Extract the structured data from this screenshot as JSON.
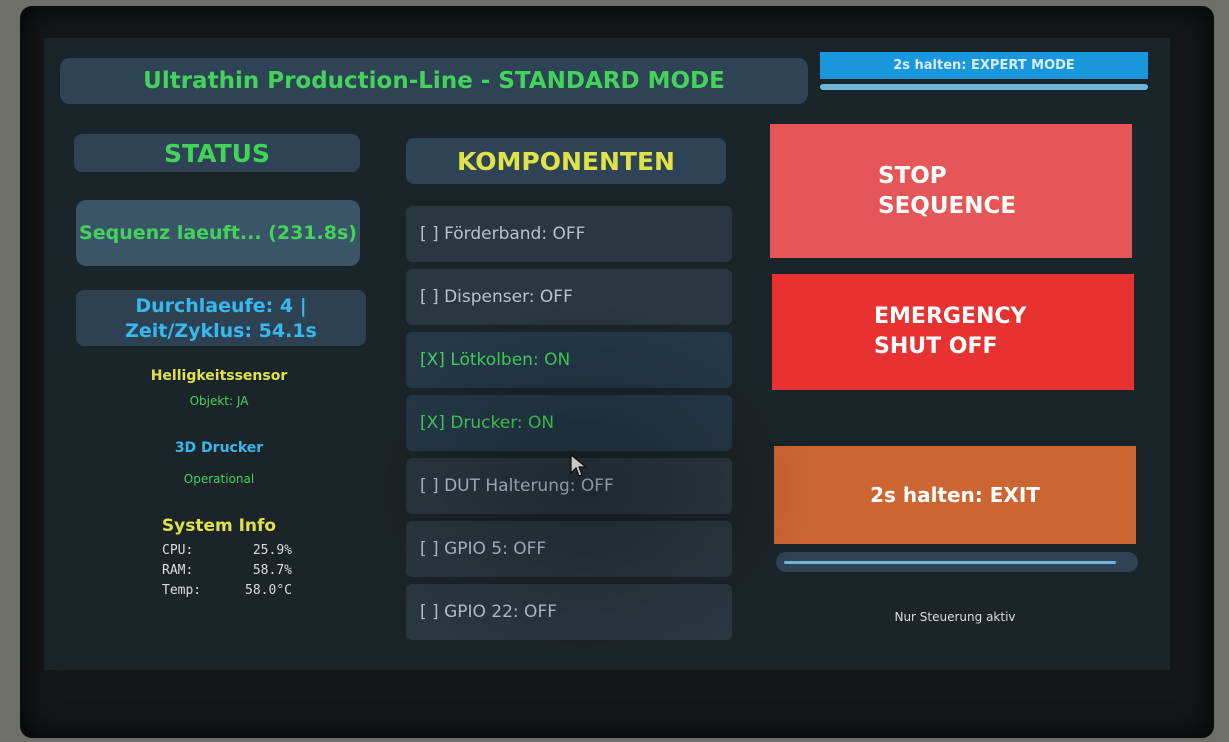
{
  "header": {
    "title": "Ultrathin Production-Line - STANDARD MODE",
    "expert_button": "2s halten: EXPERT MODE",
    "expert_hold_progress": 1.0
  },
  "status": {
    "header": "STATUS",
    "sequence": "Sequenz laeuft... (231.8s)",
    "cycles": "Durchlaeufe: 4 | Zeit/Zyklus: 54.1s",
    "brightness_sensor_title": "Helligkeitssensor",
    "brightness_sensor_value": "Objekt: JA",
    "printer_title": "3D Drucker",
    "printer_value": "Operational",
    "system_info_title": "System Info",
    "system_info": [
      {
        "label": "CPU:",
        "value": "25.9%"
      },
      {
        "label": "RAM:",
        "value": "58.7%"
      },
      {
        "label": "Temp:",
        "value": "58.0°C"
      }
    ]
  },
  "components": {
    "header": "KOMPONENTEN",
    "items": [
      {
        "label": "[ ] Förderband: OFF",
        "state": "off"
      },
      {
        "label": "[ ] Dispenser: OFF",
        "state": "off"
      },
      {
        "label": "[X] Lötkolben: ON",
        "state": "on"
      },
      {
        "label": "[X] Drucker: ON",
        "state": "on"
      },
      {
        "label": "[ ] DUT Halterung: OFF",
        "state": "off"
      },
      {
        "label": "[ ] GPIO 5: OFF",
        "state": "off"
      },
      {
        "label": "[ ] GPIO 22: OFF",
        "state": "off"
      }
    ]
  },
  "controls": {
    "stop_line1": "STOP",
    "stop_line2": "SEQUENCE",
    "emergency_line1": "EMERGENCY",
    "emergency_line2": "SHUT OFF",
    "exit_button": "2s halten: EXIT",
    "exit_hold_progress": 0.96,
    "note": "Nur Steuerung aktiv"
  },
  "colors": {
    "accent_green": "#44d35a",
    "accent_yellow": "#e0e24a",
    "accent_blue": "#37b9f0",
    "stop_red": "#e65656",
    "emergency_red": "#e83232",
    "exit_orange": "#cd6533"
  }
}
